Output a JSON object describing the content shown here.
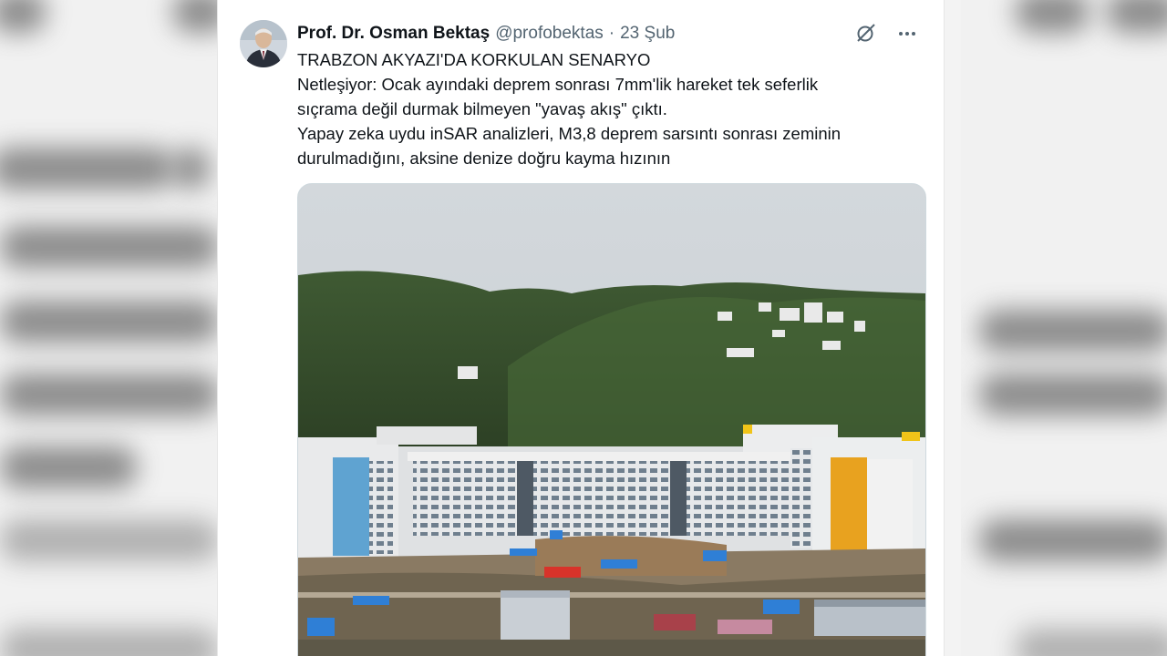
{
  "tweet": {
    "author_name": "Prof. Dr. Osman Bektaş",
    "author_handle": "@profobektas",
    "separator": "·",
    "date": "23 Şub",
    "lines": [
      "TRABZON AKYAZI'DA KORKULAN SENARYO",
      "Netleşiyor: Ocak ayındaki deprem sonrası 7mm'lik hareket tek seferlik",
      "sıçrama değil durmak bilmeyen \"yavaş akış\" çıktı.",
      "Yapay zeka uydu inSAR analizleri, M3,8 deprem sarsıntı sonrası zeminin",
      "durulmadığını, aksine denize doğru kayma hızının"
    ],
    "grok_icon": "grok-icon",
    "more_icon": "more-icon",
    "media_icon": "photo-hospital-construction"
  },
  "colors": {
    "text_primary": "#0f1419",
    "text_secondary": "#536471",
    "card_bg": "#ffffff",
    "page_bg": "#f3f3f3"
  }
}
